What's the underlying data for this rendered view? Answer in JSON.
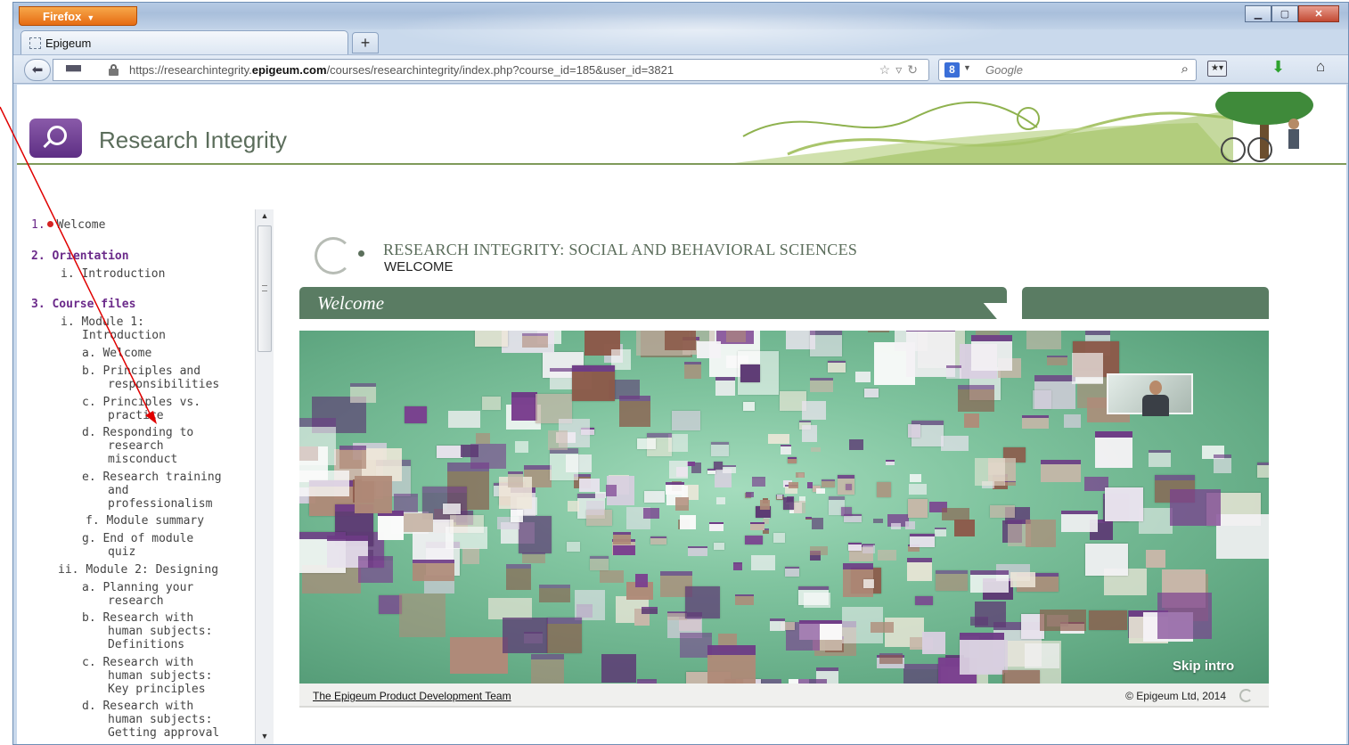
{
  "browser": {
    "menu_button": "Firefox",
    "tab_title": "Epigeum",
    "new_tab_label": "+",
    "url_prefix": "https://researchintegrity.",
    "url_host": "epigeum.com",
    "url_path": "/courses/researchintegrity/index.php?course_id=185&user_id=3821",
    "search_placeholder": "Google",
    "search_engine_letter": "8"
  },
  "site": {
    "title": "Research Integrity",
    "brand_color": "#6b2a8a",
    "accent_green": "#5a7c63"
  },
  "sidebar": {
    "items": [
      {
        "num": "1.",
        "label": "Welcome"
      },
      {
        "num": "2.",
        "label": "Orientation"
      },
      {
        "num": "i.",
        "label": "Introduction"
      },
      {
        "num": "3.",
        "label": "Course files"
      },
      {
        "num": "i.",
        "label": "Module 1:"
      },
      {
        "label": "Introduction"
      },
      {
        "num": "a.",
        "label": "Welcome"
      },
      {
        "num": "b.",
        "label": "Principles and"
      },
      {
        "label": "responsibilities"
      },
      {
        "num": "c.",
        "label": "Principles vs."
      },
      {
        "label": "practice"
      },
      {
        "num": "d.",
        "label": "Responding to"
      },
      {
        "label": "research"
      },
      {
        "label": "misconduct"
      },
      {
        "num": "e.",
        "label": "Research training"
      },
      {
        "label": "and"
      },
      {
        "label": "professionalism"
      },
      {
        "num": "f.",
        "label": "Module summary"
      },
      {
        "num": "g.",
        "label": "End of module"
      },
      {
        "label": "quiz"
      },
      {
        "num": "ii.",
        "label": "Module 2: Designing"
      },
      {
        "num": "a.",
        "label": "Planning your"
      },
      {
        "label": "research"
      },
      {
        "num": "b.",
        "label": "Research with"
      },
      {
        "label": "human subjects:"
      },
      {
        "label": "Definitions"
      },
      {
        "num": "c.",
        "label": "Research with"
      },
      {
        "label": "human subjects:"
      },
      {
        "label": "Key principles"
      },
      {
        "num": "d.",
        "label": "Research with"
      },
      {
        "label": "human subjects:"
      },
      {
        "label": "Getting approval"
      }
    ]
  },
  "course": {
    "title": "RESEARCH INTEGRITY: SOCIAL AND BEHAVIORAL SCIENCES",
    "subtitle": "WELCOME",
    "tab_label": "Welcome",
    "skip_label": "Skip intro",
    "credit": "The Epigeum Product Development Team",
    "copyright": "© Epigeum Ltd, 2014"
  }
}
